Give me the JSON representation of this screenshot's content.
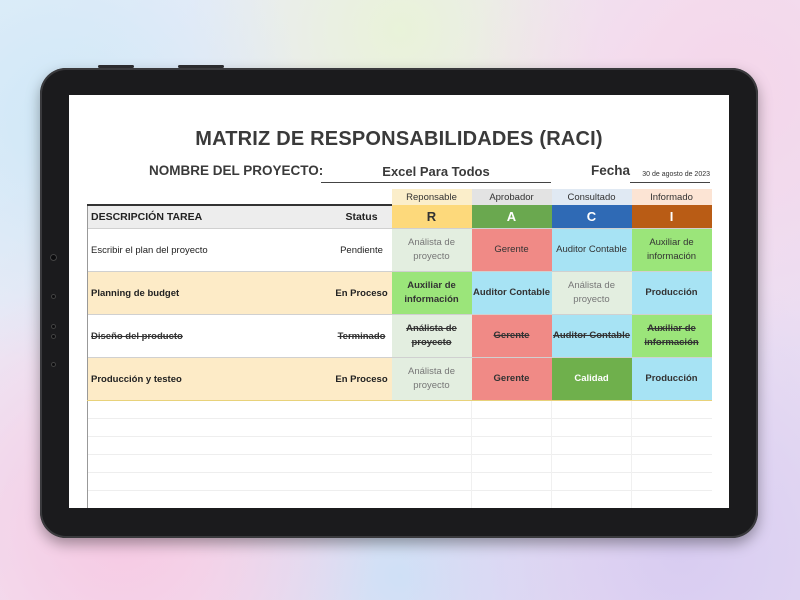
{
  "title": "MATRIZ DE RESPONSABILIDADES (RACI)",
  "project": {
    "label": "NOMBRE DEL PROYECTO:",
    "value": "Excel Para Todos"
  },
  "date": {
    "label": "Fecha",
    "value": "30 de agosto de 2023"
  },
  "roles": {
    "r": {
      "name": "Reponsable",
      "letter": "R"
    },
    "a": {
      "name": "Aprobador",
      "letter": "A"
    },
    "c": {
      "name": "Consultado",
      "letter": "C"
    },
    "i": {
      "name": "Informado",
      "letter": "I"
    }
  },
  "headers": {
    "task": "DESCRIPCIÓN TAREA",
    "status": "Status"
  },
  "rows": [
    {
      "task": "Escribir el plan del proyecto",
      "status": "Pendiente",
      "r": "Análista de proyecto",
      "a": "Gerente",
      "c": "Auditor Contable",
      "i": "Auxiliar de información"
    },
    {
      "task": "Planning de budget",
      "status": "En Proceso",
      "r": "Auxiliar de información",
      "a": "Auditor Contable",
      "c": "Análista de proyecto",
      "i": "Producción"
    },
    {
      "task": "Diseño del producto",
      "status": "Terminado",
      "r": "Análista de proyecto",
      "a": "Gerente",
      "c": "Auditor Contable",
      "i": "Auxiliar de información"
    },
    {
      "task": "Producción y testeo",
      "status": "En Proceso",
      "r": "Análista de proyecto",
      "a": "Gerente",
      "c": "Calidad",
      "i": "Producción"
    }
  ],
  "colors": {
    "accent_r": "#fdd97b",
    "accent_a": "#6aa84f",
    "accent_c": "#2f6ab5",
    "accent_i": "#b95c15",
    "cell_red": "#f08a86",
    "cell_cyan": "#a7e3f4",
    "cell_green": "#9be57a",
    "cell_gray": "#e3eee0",
    "row_highlight": "#fdebc7"
  }
}
